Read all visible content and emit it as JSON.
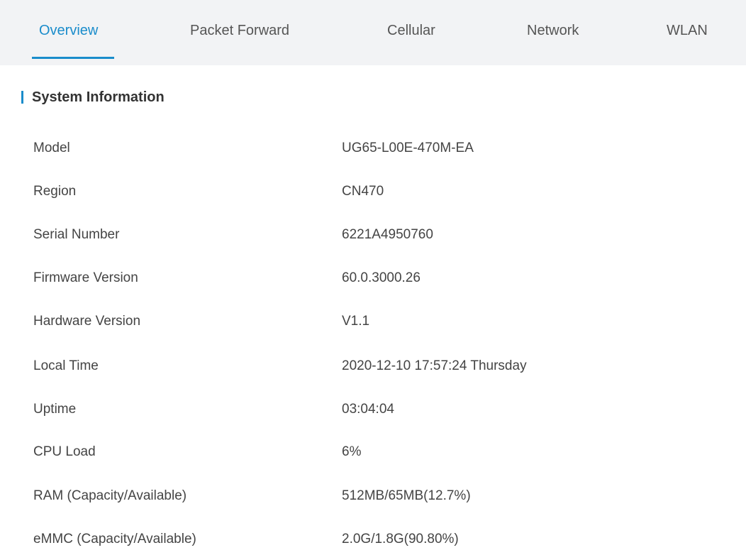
{
  "tabs": [
    {
      "label": "Overview",
      "active": true
    },
    {
      "label": "Packet Forward",
      "active": false
    },
    {
      "label": "Cellular",
      "active": false
    },
    {
      "label": "Network",
      "active": false
    },
    {
      "label": "WLAN",
      "active": false
    }
  ],
  "section": {
    "title": "System Information"
  },
  "info_rows": [
    {
      "label": "Model",
      "value": "UG65-L00E-470M-EA"
    },
    {
      "label": "Region",
      "value": "CN470"
    },
    {
      "label": "Serial Number",
      "value": "6221A4950760"
    },
    {
      "label": "Firmware Version",
      "value": "60.0.3000.26"
    },
    {
      "label": "Hardware Version",
      "value": "V1.1"
    },
    {
      "label": "Local Time",
      "value": "2020-12-10 17:57:24 Thursday"
    },
    {
      "label": "Uptime",
      "value": "03:04:04"
    },
    {
      "label": "CPU Load",
      "value": "6%"
    },
    {
      "label": "RAM (Capacity/Available)",
      "value": "512MB/65MB(12.7%)"
    },
    {
      "label": "eMMC (Capacity/Available)",
      "value": "2.0G/1.8G(90.80%)"
    }
  ],
  "colors": {
    "accent": "#1a8ccb",
    "tabbar_bg": "#f2f3f5"
  }
}
